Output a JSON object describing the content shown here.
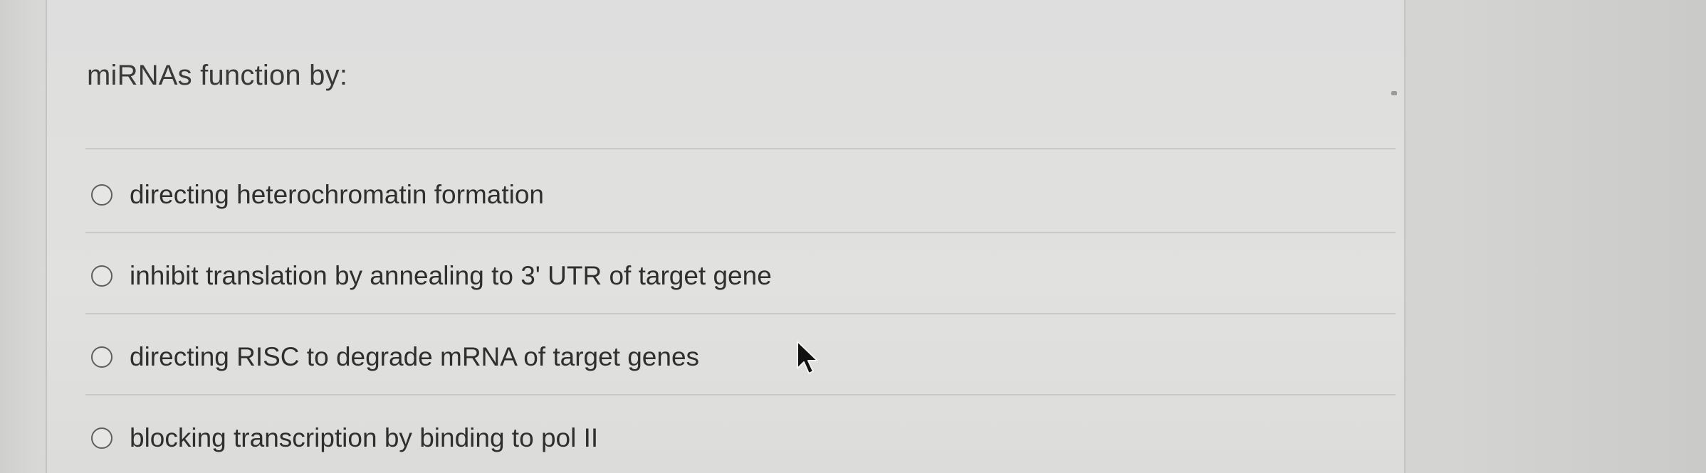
{
  "question": {
    "text": "miRNAs function by:"
  },
  "options": [
    {
      "label": "directing heterochromatin formation",
      "selected": false
    },
    {
      "label": "inhibit translation by annealing to 3' UTR of target gene",
      "selected": false
    },
    {
      "label": "directing RISC to degrade mRNA of target genes",
      "selected": false
    },
    {
      "label": "blocking transcription by binding to pol II",
      "selected": false
    }
  ],
  "icons": {
    "radio": "radio-button-icon",
    "cursor": "mouse-pointer-icon"
  },
  "colors": {
    "panel": "#e0e0de",
    "text": "#333333",
    "radio_border": "#5f5f5f"
  }
}
